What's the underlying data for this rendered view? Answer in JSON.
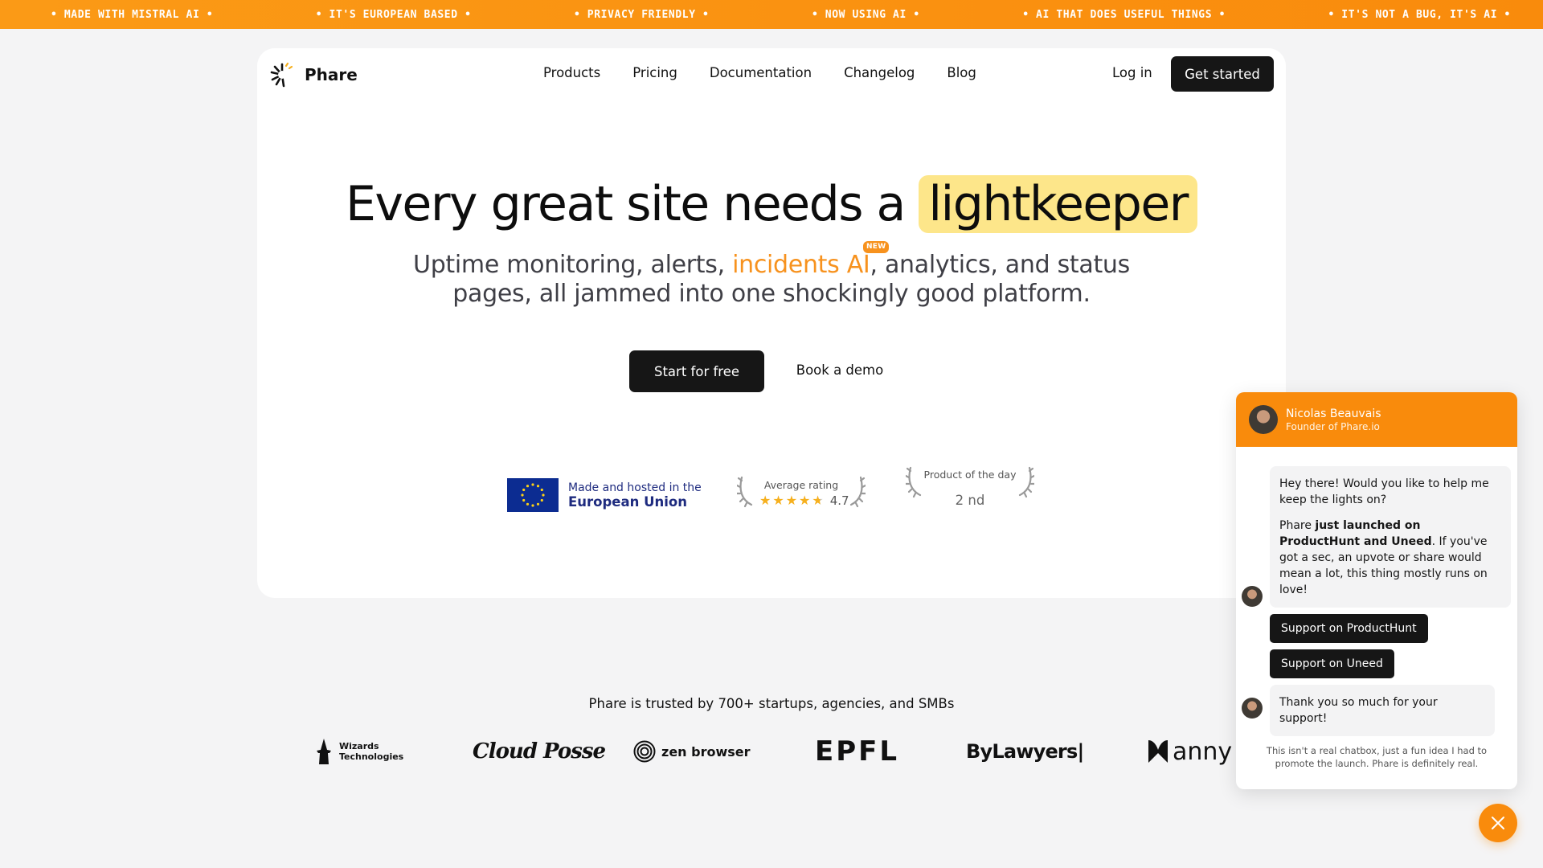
{
  "ticker": [
    "• MADE WITH MISTRAL AI •",
    "• IT'S EUROPEAN BASED •",
    "• PRIVACY FRIENDLY •",
    "• NOW USING AI •",
    "• AI THAT DOES USEFUL THINGS •",
    "• IT'S NOT A BUG, IT'S AI •"
  ],
  "brand": {
    "name": "Phare",
    "icon": "lighthouse-logo-icon"
  },
  "nav": {
    "links": [
      "Products",
      "Pricing",
      "Documentation",
      "Changelog",
      "Blog"
    ],
    "login": "Log in",
    "cta": "Get started"
  },
  "hero": {
    "title_main": "Every great site needs a",
    "title_highlight": "lightkeeper",
    "subtitle_part1": "Uptime monitoring, alerts,",
    "subtitle_link": "incidents AI",
    "new_badge": "NEW",
    "subtitle_part2": ", analytics, and status",
    "subtitle_line2": "pages, all jammed into one shockingly good platform.",
    "primary_button": "Start for free",
    "secondary_button": "Book a demo"
  },
  "badges": {
    "eu_line1": "Made and hosted in the",
    "eu_line2": "European Union",
    "rating_label": "Average rating",
    "rating_value": "4.7",
    "rating_stars": 4.7,
    "potd_label": "Product of the day",
    "potd_rank": "2 nd"
  },
  "trusted": {
    "text": "Phare is trusted by 700+ startups, agencies, and SMBs",
    "clients": [
      {
        "name": "Wizards Technologies",
        "line1": "Wizards",
        "line2": "Technologies"
      },
      {
        "name": "Cloud Posse",
        "text": "Cloud Posse"
      },
      {
        "name": "zen browser",
        "text": "zen browser"
      },
      {
        "name": "EPFL",
        "text": "EPFL"
      },
      {
        "name": "ByLawyers",
        "text": "ByLawyers|"
      },
      {
        "name": "anny",
        "text": "anny"
      }
    ]
  },
  "chat": {
    "name": "Nicolas Beauvais",
    "role": "Founder of Phare.io",
    "msg1": "Hey there! Would you like to help me keep the lights on?",
    "msg2_pre": "Phare ",
    "msg2_bold": "just launched on ProductHunt and Uneed",
    "msg2_post": ". If you've got a sec, an upvote or share would mean a lot, this thing mostly runs on love!",
    "btn1": "Support on ProductHunt",
    "btn2": "Support on Uneed",
    "msg3": "Thank you so much for your support!",
    "footer": "This isn't a real chatbox, just a fun idea I had to promote the launch. Phare is definitely real."
  },
  "colors": {
    "accent": "#f98b0c",
    "highlight": "#fde68a",
    "dark": "#161616",
    "eu_blue": "#0c2c91"
  }
}
